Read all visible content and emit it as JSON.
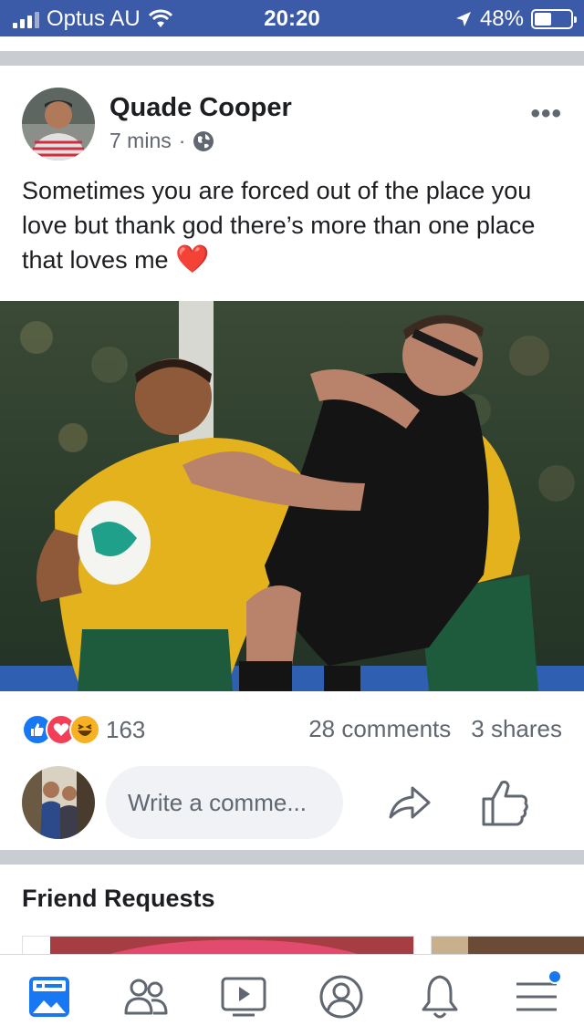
{
  "status_bar": {
    "carrier": "Optus AU",
    "time": "20:20",
    "battery": "48%",
    "battery_level": 0.48
  },
  "post": {
    "author": "Quade Cooper",
    "time": "7 mins",
    "separator": "·",
    "more": "•••",
    "text": "Sometimes you are forced out of the place you love but thank god there’s more than one place that loves me",
    "heart": "❤️",
    "reactions": {
      "count": "163",
      "icons": [
        "like-reaction-icon",
        "love-reaction-icon",
        "haha-reaction-icon"
      ],
      "colors": {
        "like": "#1877f2",
        "love": "#f33e58",
        "haha": "#f7b125"
      }
    },
    "comments": "28 comments",
    "shares": "3 shares",
    "comment_placeholder": "Write a comme..."
  },
  "friend_requests": {
    "title": "Friend Requests"
  },
  "tab_bar": {
    "tabs": [
      "news-feed-tab",
      "friends-tab",
      "watch-tab",
      "profile-tab",
      "notifications-tab",
      "menu-tab"
    ],
    "active_color": "#1877f2"
  }
}
